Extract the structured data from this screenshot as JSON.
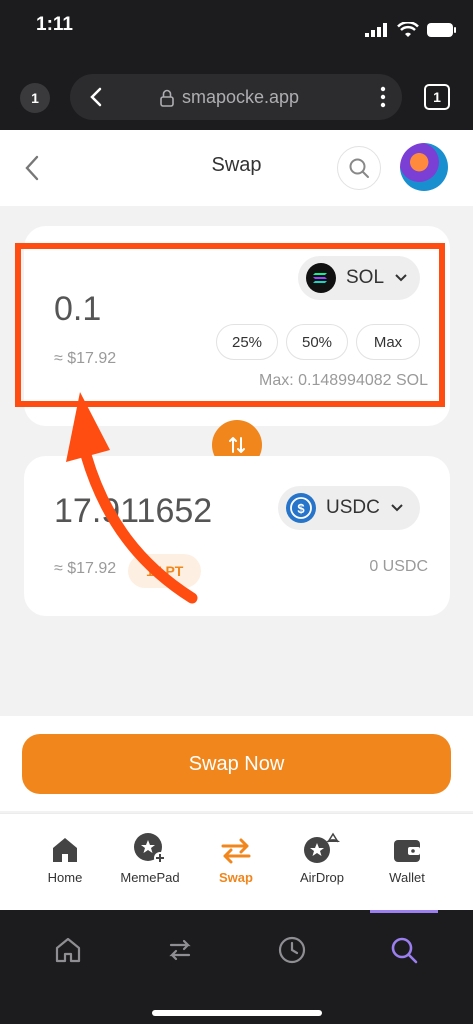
{
  "status_bar": {
    "time": "1:11"
  },
  "browser": {
    "tab_count_left": "1",
    "url": "smapocke.app",
    "tab_count_right": "1"
  },
  "header": {
    "title": "Swap"
  },
  "from_card": {
    "amount": "0.1",
    "fiat": "≈ $17.92",
    "token": "SOL",
    "percent_buttons": [
      "25%",
      "50%",
      "Max"
    ],
    "max_balance": "Max: 0.148994082 SOL"
  },
  "to_card": {
    "amount": "17.911652",
    "fiat": "≈ $17.92",
    "token": "USDC",
    "points_badge": "17 PT",
    "balance": "0 USDC"
  },
  "actions": {
    "swap_now": "Swap Now"
  },
  "bottom_nav": {
    "items": [
      {
        "label": "Home",
        "icon": "home-icon"
      },
      {
        "label": "MemePad",
        "icon": "memepad-icon"
      },
      {
        "label": "Swap",
        "icon": "swap-arrows-icon",
        "active": true
      },
      {
        "label": "AirDrop",
        "icon": "airdrop-icon"
      },
      {
        "label": "Wallet",
        "icon": "wallet-icon"
      }
    ]
  },
  "colors": {
    "accent": "#f0861c",
    "annotation": "#ff4d12",
    "browser_active": "#9b7ff0"
  }
}
